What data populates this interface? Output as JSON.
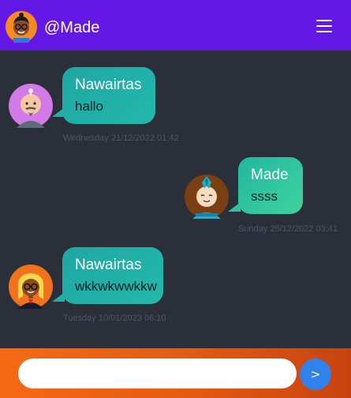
{
  "header": {
    "title": "@Made",
    "avatar_icon": "user-avatar-glasses-icon",
    "menu_icon": "hamburger-menu-icon",
    "background": "#6418e6"
  },
  "messages": [
    {
      "direction": "incoming",
      "sender": "Nawairtas",
      "text": "hallo",
      "timestamp": "Wednesday 21/12/2022 01:42",
      "avatar_icon": "avatar-bald-mustache-icon"
    },
    {
      "direction": "outgoing",
      "sender": "Made",
      "text": "ssss",
      "timestamp": "Sunday 25/12/2022 03:41",
      "avatar_icon": "avatar-mohawk-icon"
    },
    {
      "direction": "incoming",
      "sender": "Nawairtas",
      "text": "wkkwkwwkkw",
      "timestamp": "Tuesday 10/01/2023 06:10",
      "avatar_icon": "avatar-blonde-glasses-icon"
    }
  ],
  "composer": {
    "input_value": "",
    "send_label": ">",
    "send_icon": "send-icon"
  },
  "colors": {
    "background": "#2b2f3a",
    "incoming_bubble": "#21b0a8",
    "outgoing_bubble": "#2fc3a1",
    "footer_start": "#f56a14",
    "footer_end": "#c84210",
    "send_button": "#2f82ea"
  }
}
